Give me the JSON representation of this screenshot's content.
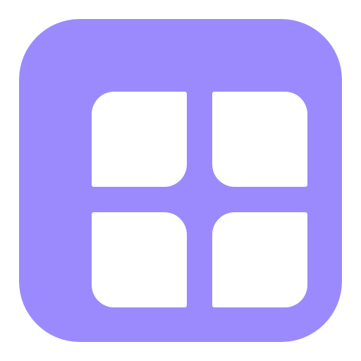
{
  "icon": {
    "name": "grid-apps-icon",
    "background_color": "#9b8afe",
    "tile_color": "#ffffff"
  }
}
